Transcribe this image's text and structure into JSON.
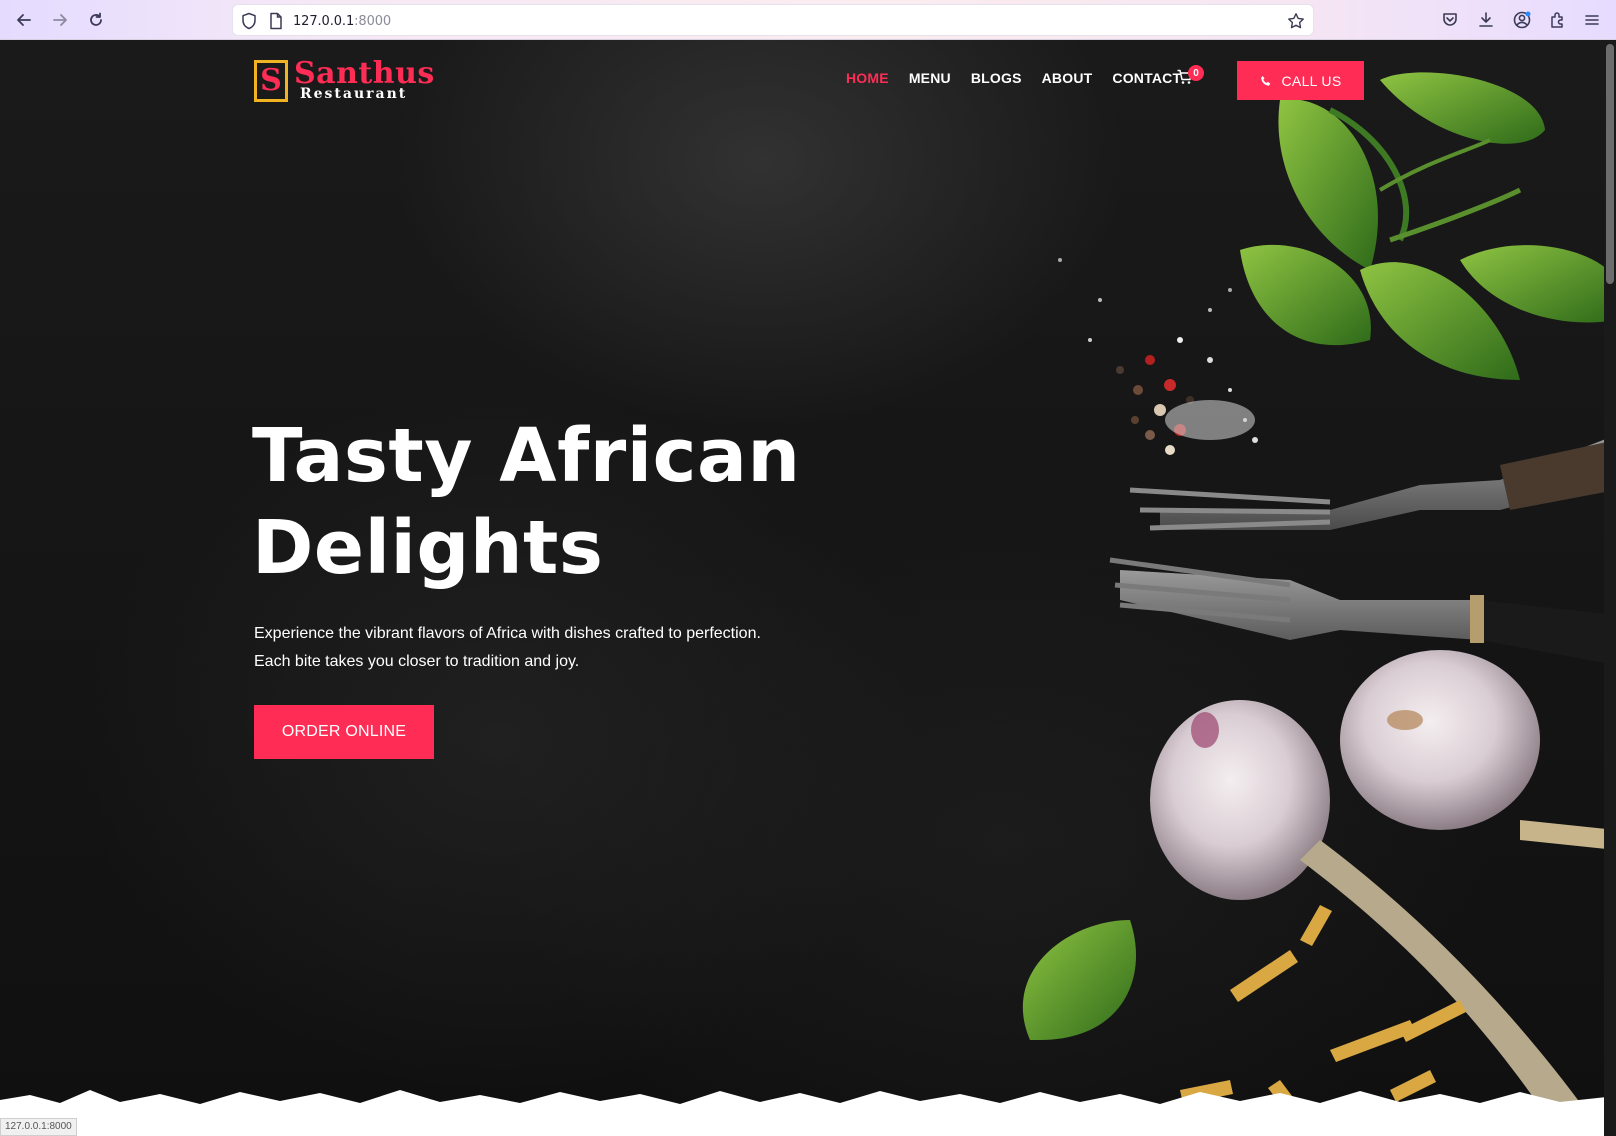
{
  "browser": {
    "url_host": "127.0.0.1",
    "url_port": ":8000",
    "status_url": "127.0.0.1:8000"
  },
  "header": {
    "logo_letter": "S",
    "brand": "Santhus",
    "brand_sub": "Restaurant",
    "nav": [
      "HOME",
      "MENU",
      "BLOGS",
      "ABOUT",
      "CONTACT"
    ],
    "active_nav": "HOME",
    "cart_count": "0",
    "call_label": "CALL US"
  },
  "hero": {
    "title_line1": "Tasty African",
    "title_line2": "Delights",
    "text_line1": "Experience the vibrant flavors of Africa with dishes crafted to perfection.",
    "text_line2": "Each bite takes you closer to tradition and joy.",
    "order_label": "ORDER ONLINE"
  },
  "colors": {
    "accent": "#ff2d55",
    "logo_border": "#f1b321",
    "background": "#151515"
  },
  "icons": [
    "back-arrow-icon",
    "forward-arrow-icon",
    "reload-icon",
    "shield-icon",
    "page-icon",
    "bookmark-star-icon",
    "pocket-icon",
    "download-icon",
    "account-icon",
    "extensions-icon",
    "menu-icon",
    "cart-icon",
    "phone-icon"
  ]
}
